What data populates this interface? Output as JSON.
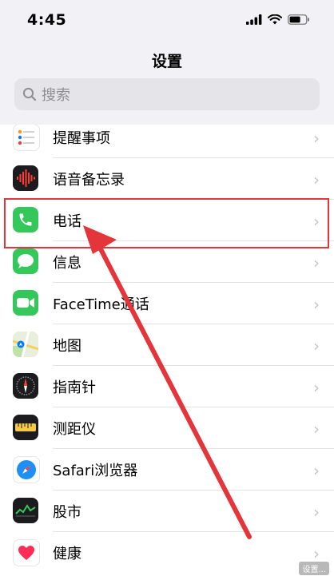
{
  "status_bar": {
    "time": "4:45"
  },
  "nav": {
    "title": "设置"
  },
  "search": {
    "placeholder": "搜索"
  },
  "settings_items": [
    {
      "label": "提醒事项",
      "icon": "reminders-icon"
    },
    {
      "label": "语音备忘录",
      "icon": "voice-memos-icon"
    },
    {
      "label": "电话",
      "icon": "phone-icon"
    },
    {
      "label": "信息",
      "icon": "messages-icon"
    },
    {
      "label": "FaceTime通话",
      "icon": "facetime-icon"
    },
    {
      "label": "地图",
      "icon": "maps-icon"
    },
    {
      "label": "指南针",
      "icon": "compass-icon"
    },
    {
      "label": "测距仪",
      "icon": "measure-icon"
    },
    {
      "label": "Safari浏览器",
      "icon": "safari-icon"
    },
    {
      "label": "股市",
      "icon": "stocks-icon"
    },
    {
      "label": "健康",
      "icon": "health-icon"
    }
  ],
  "annotation": {
    "highlight_color": "#e3353a",
    "highlighted_item": "电话"
  },
  "watermark": {
    "text": "设置..."
  }
}
